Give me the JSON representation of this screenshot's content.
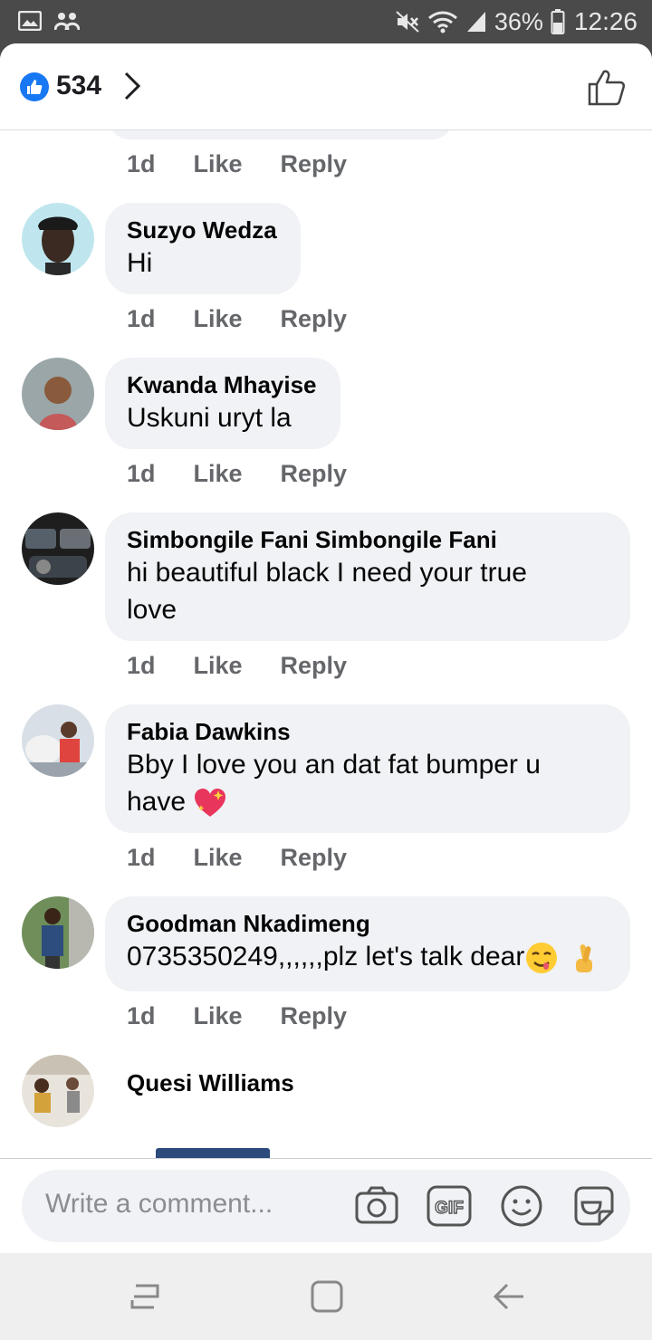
{
  "status_bar": {
    "battery": "36%",
    "time": "12:26"
  },
  "header": {
    "reaction_count": "534"
  },
  "top_partial": {
    "time": "1d",
    "like": "Like",
    "reply": "Reply"
  },
  "comments": [
    {
      "name": "Suzyo Wedza",
      "text": "Hi",
      "time": "1d",
      "like": "Like",
      "reply": "Reply"
    },
    {
      "name": "Kwanda Mhayise",
      "text": "Uskuni uryt la",
      "time": "1d",
      "like": "Like",
      "reply": "Reply"
    },
    {
      "name": "Simbongile Fani Simbongile Fani",
      "text_line1": "hi beautiful black I need your true",
      "text_line2": "love",
      "time": "1d",
      "like": "Like",
      "reply": "Reply"
    },
    {
      "name": "Fabia Dawkins",
      "text_line1": "Bby I love you  an dat fat bumper u",
      "text_line2": "have",
      "time": "1d",
      "like": "Like",
      "reply": "Reply"
    },
    {
      "name": "Goodman Nkadimeng",
      "text": "0735350249,,,,,,plz let's talk dear",
      "time": "1d",
      "like": "Like",
      "reply": "Reply"
    },
    {
      "name": "Quesi Williams"
    }
  ],
  "composer": {
    "placeholder": "Write a comment..."
  },
  "colors": {
    "brand": "#1877f2",
    "bubble": "#f0f2f5",
    "meta": "#65676b"
  }
}
